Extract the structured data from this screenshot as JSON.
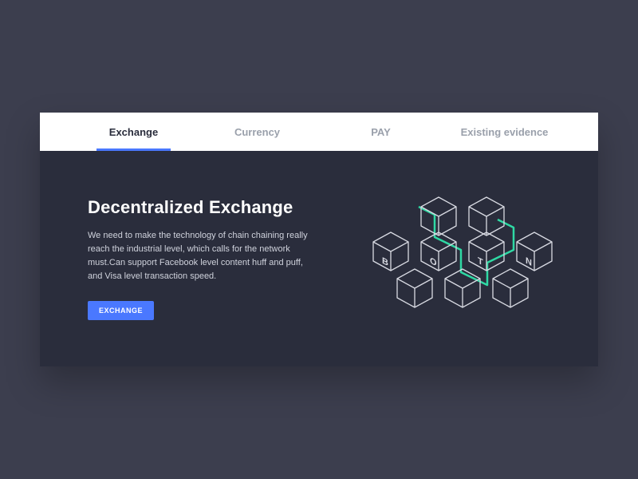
{
  "tabs": [
    {
      "label": "Exchange",
      "active": true
    },
    {
      "label": "Currency",
      "active": false
    },
    {
      "label": "PAY",
      "active": false
    },
    {
      "label": "Existing evidence",
      "active": false
    }
  ],
  "main": {
    "heading": "Decentralized Exchange",
    "body": "We need to make the technology of chain chaining really reach the industrial level, which calls for the network must.Can support Facebook level content huff and puff, and Visa level transaction speed.",
    "button_label": "EXCHANGE"
  },
  "illustration": {
    "cube_letters": [
      "B",
      "O",
      "T",
      "N"
    ]
  },
  "colors": {
    "accent": "#4a78ff",
    "panel_bg": "#2a2d3c",
    "page_bg": "#3c3e4e",
    "highlight": "#2fd9a4"
  }
}
